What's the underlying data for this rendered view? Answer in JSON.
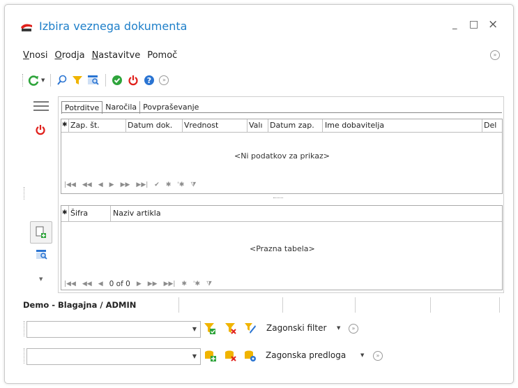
{
  "window": {
    "title": "Izbira veznega dokumenta",
    "minimize": "_",
    "maximize": "□",
    "close": "×"
  },
  "menu": {
    "items": [
      {
        "mnemonic": "V",
        "rest": "nosi"
      },
      {
        "mnemonic": "O",
        "rest": "rodja"
      },
      {
        "mnemonic": "N",
        "rest": "astavitve"
      },
      {
        "mnemonic": "",
        "rest": "Pomoč"
      }
    ]
  },
  "top_grid": {
    "tabs": [
      "Potrditve",
      "Naročila",
      "Povpraševanje"
    ],
    "active_tab": "Potrditve",
    "columns": [
      "Zap. št.",
      "Datum dok.",
      "Vrednost",
      "Valı",
      "Datum zap.",
      "Ime dobavitelja",
      "Del"
    ],
    "empty_text": "<Ni podatkov za prikaz>"
  },
  "bottom_grid": {
    "columns": [
      "Šifra",
      "Naziv artikla"
    ],
    "empty_text": "<Prazna tabela>",
    "record_counter": "0 of 0"
  },
  "status": {
    "user_text": "Demo - Blagajna / ADMIN"
  },
  "filter": {
    "value": "",
    "label": "Zagonski filter"
  },
  "template": {
    "value": "",
    "label": "Zagonska predloga"
  },
  "colors": {
    "accent": "#1e7fc9",
    "green": "#2ea43b",
    "red": "#e0201b",
    "yellow": "#f0b400",
    "blue": "#2a74d2"
  }
}
